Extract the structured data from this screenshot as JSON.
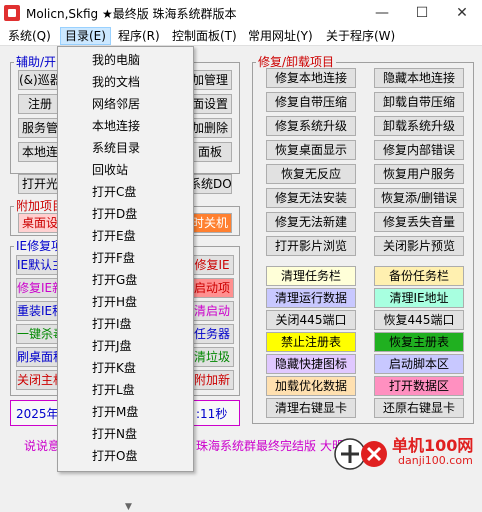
{
  "window": {
    "title": "Molicn,Skfig ★最终版 珠海系统群版本",
    "minimize": "—",
    "maximize": "☐",
    "close": "✕"
  },
  "menubar": [
    "系统(Q)",
    "目录(E)",
    "程序(R)",
    "控制面板(T)",
    "常用网址(Y)",
    "关于程序(W)"
  ],
  "left_panel": {
    "group1_label": "辅助/开",
    "group1_buttons": [
      "(&)巡器",
      "注册",
      "服务管",
      "本地连"
    ],
    "open_btn": "打开光",
    "group2_label": "附加项目",
    "group2_button": "桌面设",
    "group3_label": "IE修复项",
    "group3_buttons": [
      "IE默认主",
      "修复IE新",
      "重装IE程",
      "一键杀毒",
      "刷桌面程",
      "关闭主机"
    ],
    "date_text": "2025年0",
    "footer_text": "说说意"
  },
  "middle_partial": {
    "group1_buttons": [
      "加管理",
      "面设置",
      "加删除",
      "面板"
    ],
    "dos_button": "系统DOS",
    "shutdown_button": "时关机",
    "ie_buttons": [
      "修复IE",
      "启动项",
      "清启动",
      "任务器",
      "清垃圾",
      "附加新"
    ],
    "time_text": ":11秒",
    "footer_text": "珠海系统群最终完结版",
    "footer_text2": "大明湖"
  },
  "right_panel": {
    "group_label": "修复/卸载项目",
    "rows1": [
      [
        "修复本地连接",
        "隐藏本地连接"
      ],
      [
        "修复自带压缩",
        "卸载自带压缩"
      ],
      [
        "修复系统升级",
        "卸载系统升级"
      ],
      [
        "恢复桌面显示",
        "修复内部错误"
      ],
      [
        "恢复无反应",
        "恢复用户服务"
      ],
      [
        "修复无法安装",
        "恢复添/删错误"
      ],
      [
        "修复无法新建",
        "修复丢失音量"
      ],
      [
        "打开影片浏览",
        "关闭影片预览"
      ]
    ],
    "rows2": [
      [
        "清理任务栏",
        "备份任务栏"
      ],
      [
        "清理运行数据",
        "清理IE地址"
      ],
      [
        "关闭445端口",
        "恢复445端口"
      ],
      [
        "禁止注册表",
        "恢复主册表"
      ],
      [
        "隐藏快捷图标",
        "启动脚本区"
      ],
      [
        "加载优化数据",
        "打开数据区"
      ],
      [
        "清理右键显卡",
        "还原右键显卡"
      ]
    ]
  },
  "dropdown": {
    "items": [
      "我的电脑",
      "我的文档",
      "网络邻居",
      "本地连接",
      "系统目录",
      "回收站",
      "打开C盘",
      "打开D盘",
      "打开E盘",
      "打开F盘",
      "打开G盘",
      "打开H盘",
      "打开I盘",
      "打开J盘",
      "打开K盘",
      "打开L盘",
      "打开M盘",
      "打开N盘",
      "打开O盘"
    ],
    "more_arrow": "▼"
  },
  "watermark": {
    "site": "单机100网",
    "url": "danji100.com"
  },
  "colors": {
    "row2_bg": [
      [
        "#ffffd8",
        "#fff0b0"
      ],
      [
        "#c8c8ff",
        "#a8ffe0"
      ],
      [
        "#e1e1e1",
        "#e1e1e1"
      ],
      [
        "#ffff00",
        "#20b020"
      ],
      [
        "#e0c8ff",
        "#c8c8ff"
      ],
      [
        "#ffe0b0",
        "#ff90c0"
      ],
      [
        "#e1e1e1",
        "#e1e1e1"
      ]
    ],
    "mid_ie_bg": [
      "#e1e1e1",
      "#ff9090",
      "#e1e1e1",
      "#e1e1e1",
      "#e1e1e1",
      "#e1e1e1"
    ],
    "mid_ie_fg": [
      "#cc0000",
      "#cc0000",
      "#cc00cc",
      "#0000cc",
      "#008800",
      "#cc0000"
    ]
  }
}
